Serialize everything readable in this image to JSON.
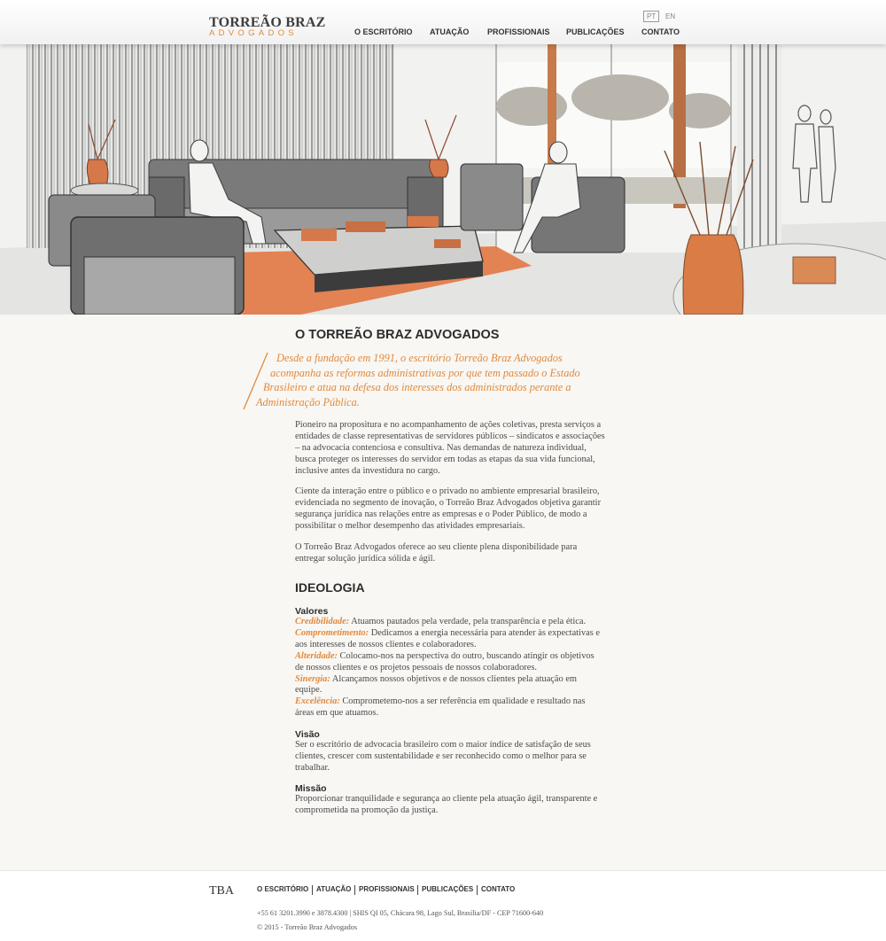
{
  "header": {
    "logo_top": "TORREÃO BRAZ",
    "logo_bottom": "ADVOGADOS",
    "lang_pt": "PT",
    "lang_en": "EN",
    "nav": [
      "O ESCRITÓRIO",
      "ATUAÇÃO",
      "PROFISSIONAIS",
      "PUBLICAÇÕES",
      "CONTATO"
    ]
  },
  "main": {
    "title": "O TORREÃO BRAZ ADVOGADOS",
    "quote_lines": [
      "Desde a fundação em 1991, o escritório Torreão Braz Advogados",
      "acompanha as reformas administrativas por que tem passado o Estado",
      "Brasileiro e atua na defesa dos interesses dos administrados perante a",
      "Administração Pública."
    ],
    "paragraphs": [
      "Pioneiro na propositura e no acompanhamento de ações coletivas, presta serviços a entidades de classe representativas de servidores públicos – sindicatos e associações – na advocacia contenciosa e consultiva. Nas demandas de natureza individual, busca proteger os interesses do servidor em todas as etapas da sua vida funcional, inclusive antes da investidura no cargo.",
      "Ciente da interação entre o público e o privado no ambiente empresarial brasileiro, evidenciada no segmento de inovação, o Torreão Braz Advogados objetiva garantir segurança jurídica nas relações entre as empresas e o Poder Público, de modo a possibilitar o melhor desempenho das atividades empresariais.",
      "O Torreão Braz Advogados oferece ao seu cliente plena disponibilidade para entregar solução jurídica sólida e ágil."
    ],
    "ideologia": {
      "title": "IDEOLOGIA",
      "valores_title": "Valores",
      "valores": [
        {
          "term": "Credibilidade:",
          "text": " Atuamos pautados pela verdade, pela transparência e pela ética."
        },
        {
          "term": "Comprometimento:",
          "text": " Dedicamos a energia necessária para atender às expectativas e aos interesses de nossos clientes e colaboradores."
        },
        {
          "term": "Alteridade:",
          "text": " Colocamo-nos na perspectiva do outro, buscando atingir os objetivos de nossos clientes e os projetos pessoais de nossos colaboradores."
        },
        {
          "term": "Sinergia:",
          "text": " Alcançamos nossos objetivos e de nossos clientes pela atuação em equipe."
        },
        {
          "term": "Excelência:",
          "text": " Comprometemo-nos a ser referência em qualidade e resultado nas áreas em que atuamos."
        }
      ],
      "visao_title": "Visão",
      "visao_text": "Ser o escritório de advocacia brasileiro com o maior índice de satisfação de seus clientes, crescer com sustentabilidade e ser reconhecido como o melhor para se trabalhar.",
      "missao_title": "Missão",
      "missao_text": "Proporcionar tranquilidade e segurança ao cliente pela atuação ágil, transparente e comprometida na promoção da justiça."
    }
  },
  "footer": {
    "logo": "TBA",
    "nav": [
      "O ESCRITÓRIO",
      "ATUAÇÃO",
      "PROFISSIONAIS",
      "PUBLICAÇÕES",
      "CONTATO"
    ],
    "address": "+55 61 3201.3990 e 3878.4300 | SHIS QI 05, Chácara 98, Lago Sul, Brasília/DF - CEP 71600-640",
    "copyright": "© 2015 - Torreão Braz Advogados"
  },
  "colors": {
    "accent": "#e2893b",
    "text": "#3a3a3a",
    "background": "#f8f7f4"
  }
}
